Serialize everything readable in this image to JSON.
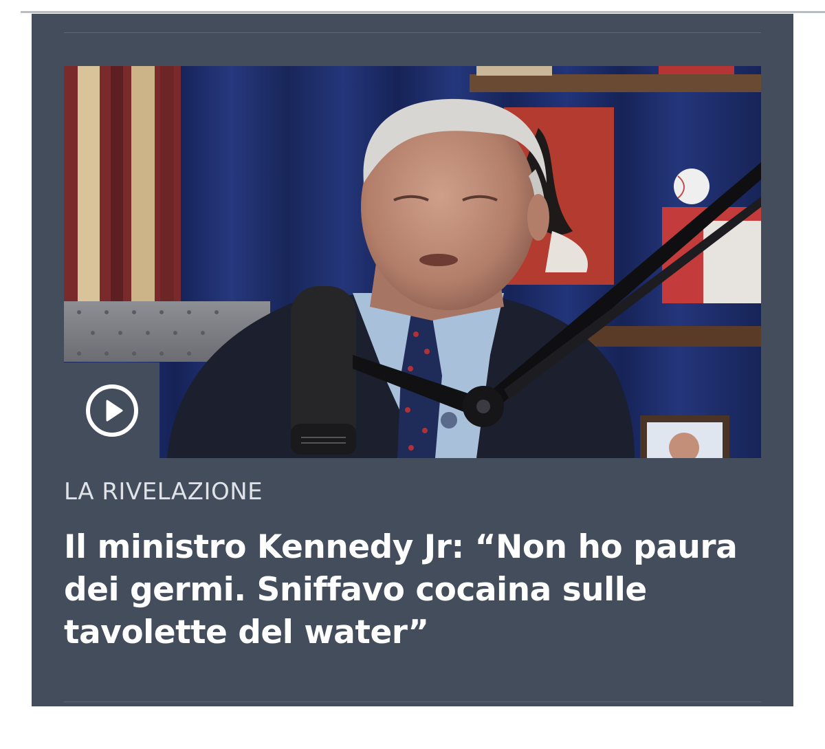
{
  "article": {
    "kicker": "LA RIVELAZIONE",
    "headline": "Il ministro Kennedy Jr: “Non ho paura dei germi. Sniffavo cocaina sulle tavolette del water”",
    "image_alt": "Robert F. Kennedy Jr. seduto davanti a un microfono da podcast",
    "media_action": "play"
  },
  "colors": {
    "card_background": "#434d5c",
    "page_background": "#ffffff",
    "kicker_text": "#dfe2e7",
    "headline_text": "#ffffff"
  },
  "icons": {
    "play": "play-icon"
  }
}
